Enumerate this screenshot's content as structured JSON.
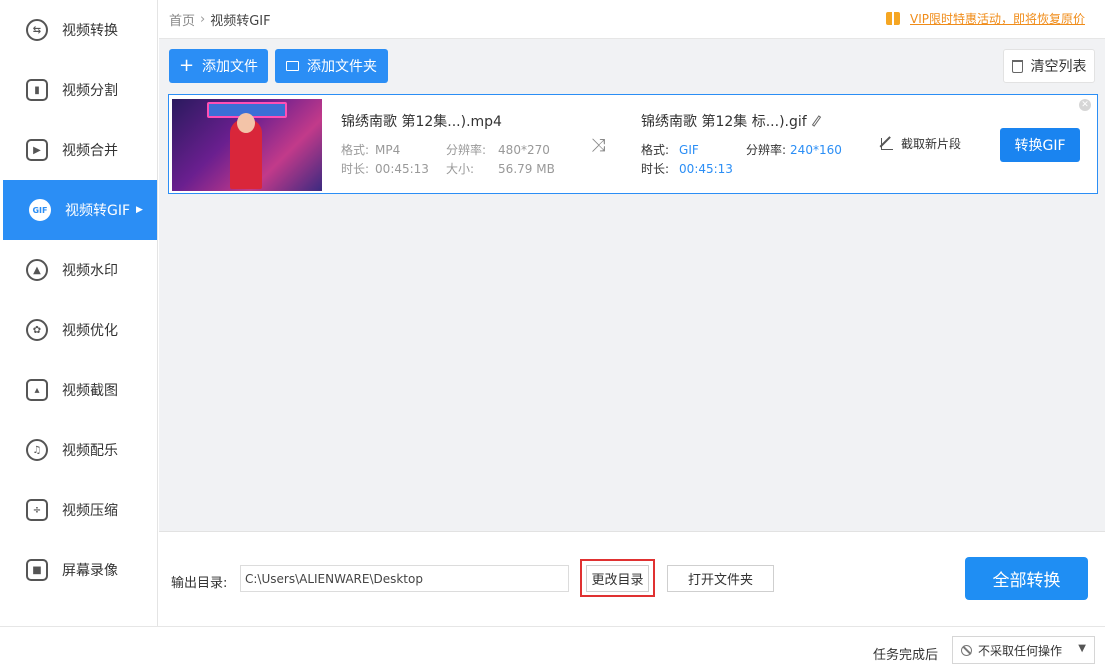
{
  "sidebar": {
    "items": [
      {
        "label": "视频转换",
        "icon": "convert-icon"
      },
      {
        "label": "视频分割",
        "icon": "split-icon"
      },
      {
        "label": "视频合并",
        "icon": "merge-icon"
      },
      {
        "label": "视频转GIF",
        "icon": "gif-icon",
        "badge": "GIF",
        "active": true
      },
      {
        "label": "视频水印",
        "icon": "watermark-icon"
      },
      {
        "label": "视频优化",
        "icon": "optimize-icon"
      },
      {
        "label": "视频截图",
        "icon": "screenshot-icon"
      },
      {
        "label": "视频配乐",
        "icon": "music-icon"
      },
      {
        "label": "视频压缩",
        "icon": "compress-icon"
      },
      {
        "label": "屏幕录像",
        "icon": "record-icon"
      }
    ]
  },
  "topbar": {
    "home": "首页",
    "current": "视频转GIF",
    "promo": "VIP限时特惠活动，即将恢复原价"
  },
  "toolbar": {
    "add_file": "添加文件",
    "add_folder": "添加文件夹",
    "clear_list": "清空列表"
  },
  "file": {
    "source": {
      "name": "锦绣南歌 第12集...).mp4",
      "format_label": "格式:",
      "format": "MP4",
      "resolution_label": "分辨率:",
      "resolution": "480*270",
      "duration_label": "时长:",
      "duration": "00:45:13",
      "size_label": "大小:",
      "size": "56.79 MB"
    },
    "target": {
      "name": "锦绣南歌 第12集 标...).gif",
      "format_label": "格式:",
      "format": "GIF",
      "resolution_label": "分辨率:",
      "resolution": "240*160",
      "duration_label": "时长:",
      "duration": "00:45:13"
    },
    "crop_label": "截取新片段",
    "convert_label": "转换GIF"
  },
  "output": {
    "label": "输出目录:",
    "path": "C:\\Users\\ALIENWARE\\Desktop",
    "change_dir": "更改目录",
    "open_folder": "打开文件夹",
    "convert_all": "全部转换"
  },
  "status": {
    "after_label": "任务完成后",
    "after_value": "不采取任何操作"
  },
  "colors": {
    "accent": "#2b8ef5",
    "promo": "#f08c19",
    "highlight": "#e03131"
  }
}
